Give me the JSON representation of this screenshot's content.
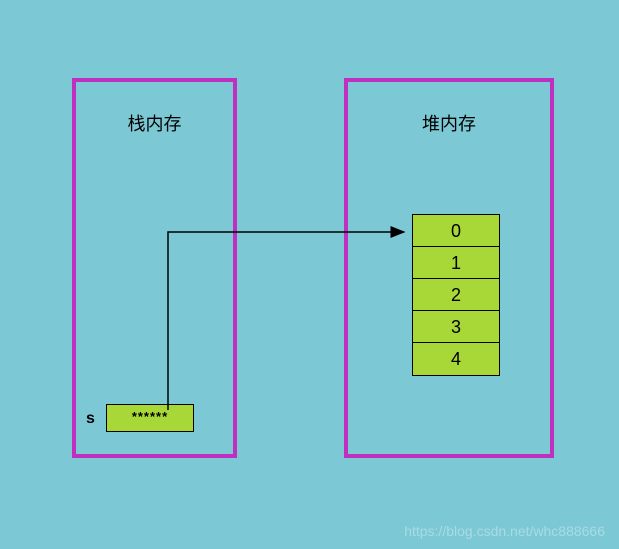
{
  "stack": {
    "label": "栈内存",
    "var_name": "s",
    "var_value": "******"
  },
  "heap": {
    "label": "堆内存",
    "cells": [
      "0",
      "1",
      "2",
      "3",
      "4"
    ]
  },
  "watermark": "https://blog.csdn.net/whc888666"
}
